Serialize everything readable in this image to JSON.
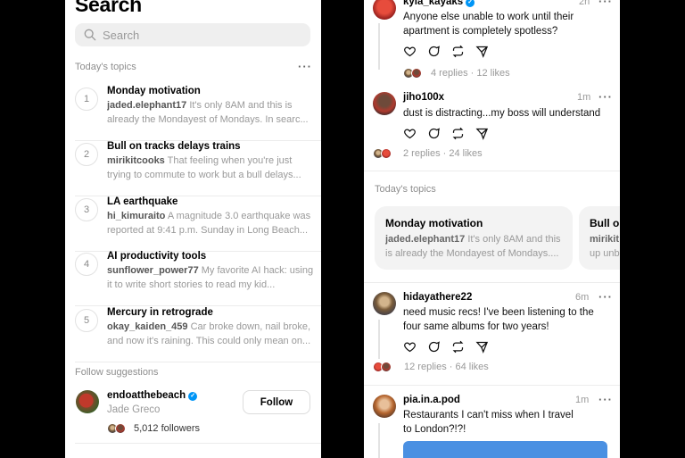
{
  "search": {
    "title": "Search",
    "placeholder": "Search"
  },
  "todays_topics_label": "Today's topics",
  "topics": [
    {
      "num": "1",
      "title": "Monday motivation",
      "user": "jaded.elephant17",
      "text": " It's only 8AM and this is already the Mondayest of Mondays. In searc..."
    },
    {
      "num": "2",
      "title": "Bull on tracks delays trains",
      "user": "mirikitcooks",
      "text": " That feeling when you're just trying to commute to work but a bull delays..."
    },
    {
      "num": "3",
      "title": "LA earthquake",
      "user": "hi_kimuraito",
      "text": " A magnitude 3.0 earthquake was reported at 9:41 p.m. Sunday in Long Beach..."
    },
    {
      "num": "4",
      "title": "AI productivity tools",
      "user": "sunflower_power77",
      "text": " My favorite AI hack: using it to write short stories to read my kid..."
    },
    {
      "num": "5",
      "title": "Mercury in retrograde",
      "user": "okay_kaiden_459",
      "text": " Car broke down, nail broke, and now it's raining. This could only mean on..."
    }
  ],
  "follow_suggestions": {
    "label": "Follow suggestions",
    "username": "endoatthebeach",
    "display_name": "Jade Greco",
    "followers": "5,012 followers",
    "follow_button": "Follow"
  },
  "feed": {
    "posts": [
      {
        "user": "kyia_kayaks",
        "time": "2h",
        "text": "Anyone else unable to work until their apartment is completely spotless?",
        "replies": "4 replies",
        "likes": "12 likes"
      },
      {
        "user": "jiho100x",
        "time": "1m",
        "text": "dust is distracting...my boss will understand",
        "replies": "2 replies",
        "likes": "24 likes"
      },
      {
        "user": "hidayathere22",
        "time": "6m",
        "text": "need music recs! I've been listening to the four same albums for two years!",
        "replies": "12 replies",
        "likes": "64 likes"
      },
      {
        "user": "pia.in.a.pod",
        "time": "1m",
        "text": "Restaurants I can't miss when I travel to London?!?!"
      }
    ],
    "topics_label": "Today's topics",
    "cards": [
      {
        "title": "Monday motivation",
        "user": "jaded.elephant17",
        "text": " It's only 8AM and this is already the Mondayest of Mondays...."
      },
      {
        "title": "Bull on",
        "user": "mirikit",
        "text": "up unb"
      }
    ],
    "separator": "·"
  },
  "icons": [
    "search-icon",
    "more-icon",
    "verified-icon",
    "heart-icon",
    "comment-icon",
    "repost-icon",
    "share-icon"
  ],
  "colors": {
    "accent": "#0095f6",
    "background": "#000000",
    "panel": "#ffffff",
    "muted_text": "#999999"
  }
}
